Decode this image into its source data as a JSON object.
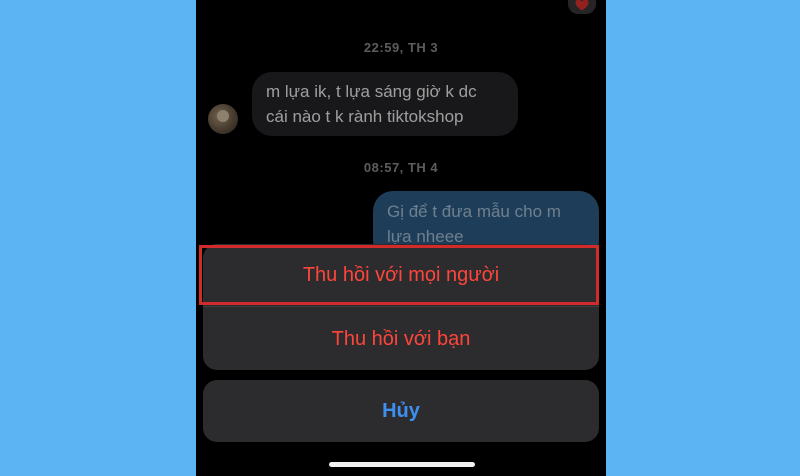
{
  "conversation": {
    "timestamps": [
      "22:59, TH 3",
      "08:57, TH 4"
    ],
    "incoming_message": {
      "line1": "m lựa ik, t lựa sáng giờ k dc",
      "line2": "cái nào t k rành tiktokshop"
    },
    "outgoing_message": {
      "line1": "Gị để t đưa mẫu cho m",
      "line2": "lựa nheee"
    },
    "reaction_icon": "heart-icon"
  },
  "action_sheet": {
    "unsend_for_everyone": "Thu hồi với mọi người",
    "unsend_for_you": "Thu hồi với bạn",
    "cancel": "Hủy"
  },
  "colors": {
    "background": "#5db4f2",
    "destructive": "#ff453a",
    "cancel": "#3f8ff0",
    "highlight": "#d12b2b"
  }
}
